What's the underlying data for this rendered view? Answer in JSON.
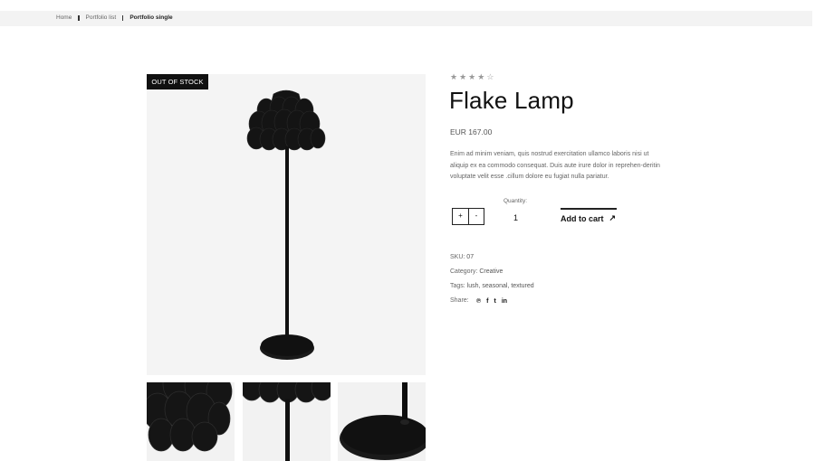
{
  "breadcrumb": {
    "items": [
      "Home",
      "Portfolio list"
    ],
    "current": "Portfolio single"
  },
  "badge": {
    "label": "OUT OF STOCK"
  },
  "product": {
    "rating": {
      "filled": 4,
      "total": 5
    },
    "title": "Flake Lamp",
    "price": "EUR 167.00",
    "description": "Enim ad minim veniam, quis nostrud exercitation ullamco laboris nisi ut aliquip ex ea commodo consequat. Duis aute irure dolor in reprehen-deritin voluptate velit esse .cillum dolore eu fugiat nulla pariatur."
  },
  "quantity": {
    "label": "Quantity:",
    "value": "1",
    "plus": "+",
    "minus": "-"
  },
  "cart": {
    "label": "Add to cart",
    "arrow": "↗"
  },
  "meta": {
    "sku_label": "SKU:",
    "sku": "07",
    "category_label": "Category:",
    "category": "Creative",
    "tags_label": "Tags:",
    "tags": "lush, seasonal, textured",
    "share_label": "Share:"
  },
  "share_icons": [
    "pinterest-icon",
    "facebook-icon",
    "twitter-icon",
    "linkedin-icon"
  ],
  "share_glyphs": [
    "℗",
    "f",
    "t",
    "in"
  ],
  "colors": {
    "accent": "#111111",
    "muted": "#666666",
    "image_bg": "#f4f4f4"
  }
}
